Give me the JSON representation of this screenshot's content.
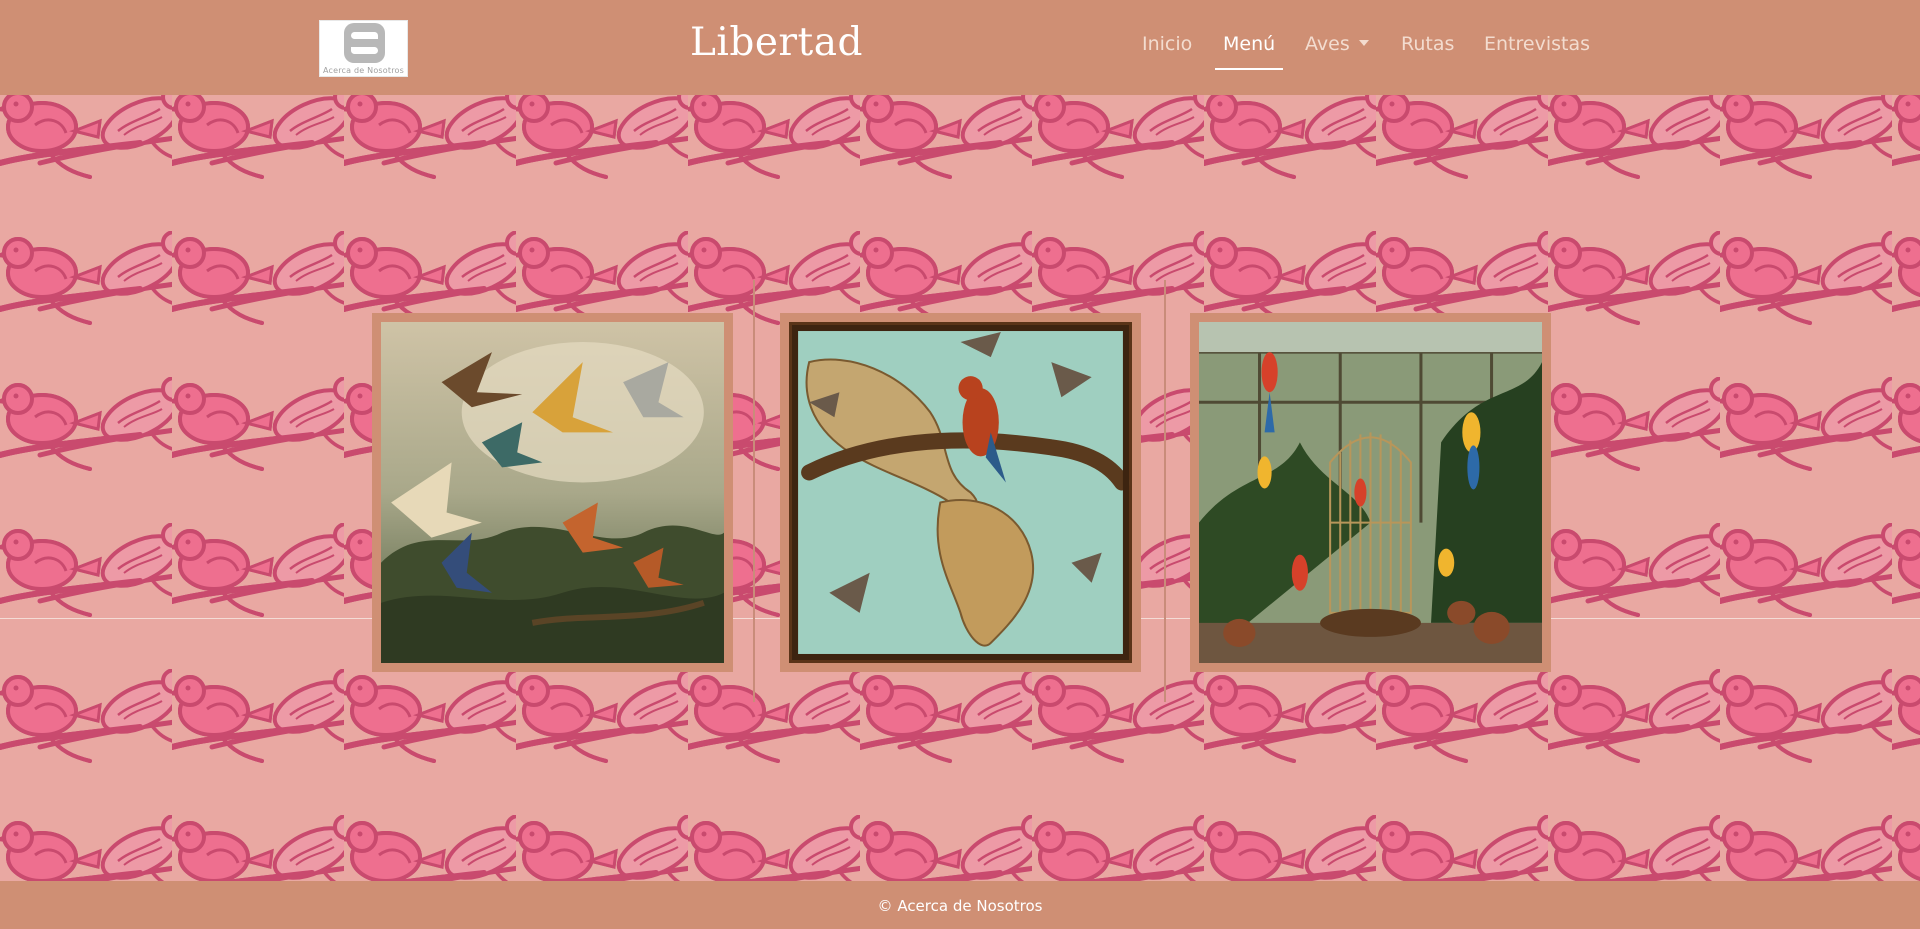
{
  "header": {
    "logo_text": "Acerca de Nosotros",
    "brand": "Libertad",
    "nav": [
      {
        "label": "Inicio",
        "active": false
      },
      {
        "label": "Menú",
        "active": true
      },
      {
        "label": "Aves",
        "active": false,
        "dropdown": true
      },
      {
        "label": "Rutas",
        "active": false
      },
      {
        "label": "Entrevistas",
        "active": false
      }
    ]
  },
  "gallery": {
    "images": [
      {
        "subject": "flock of birds flying over forest painting"
      },
      {
        "subject": "birds on map of the Americas painting"
      },
      {
        "subject": "parrots in greenhouse with birdcage painting"
      }
    ]
  },
  "footer": {
    "text": "© Acerca de Nosotros"
  },
  "colors": {
    "header_bg": "#cf8f74",
    "page_bg": "#e9a8a2",
    "bird_pattern": "#c94a6e",
    "nav_text": "#f3dccf",
    "nav_active": "#ffffff"
  }
}
